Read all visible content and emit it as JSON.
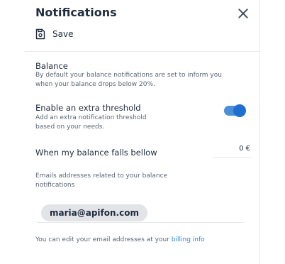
{
  "header": {
    "title": "Notifications",
    "save_label": "Save"
  },
  "balance": {
    "title": "Balance",
    "description": "By default your balance notifications are set to inform you when your balance drops below 20%."
  },
  "extra_threshold": {
    "title": "Enable an extra threshold",
    "description": "Add an extra notification threshold based on your needs.",
    "enabled": true
  },
  "balance_falls": {
    "label": "When my balance falls bellow",
    "amount": "0 €"
  },
  "emails": {
    "description": "Emails addresses related to your balance notifications",
    "addresses": [
      "maria@apifon.com"
    ]
  },
  "footer": {
    "text": "You can edit your email addresses at your ",
    "link_text": "billing info"
  },
  "colors": {
    "accent": "#1f6fd1",
    "link": "#1f88e5",
    "chip_bg": "#e2e4e8"
  }
}
